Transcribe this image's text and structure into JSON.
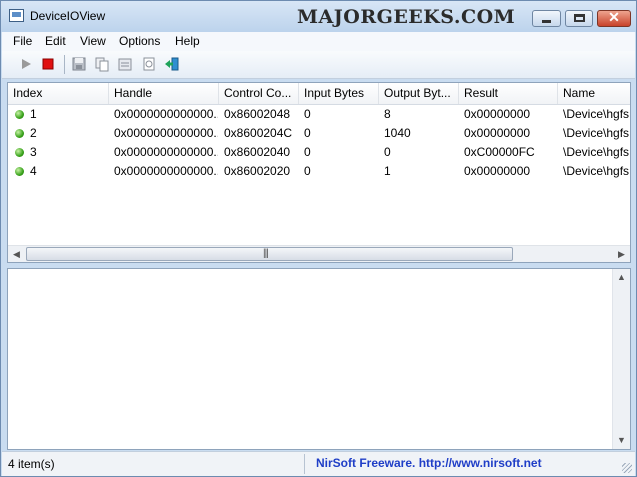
{
  "window": {
    "title": "DeviceIOView",
    "watermark": "MajorGeeks.com"
  },
  "menu": [
    {
      "label": "File"
    },
    {
      "label": "Edit"
    },
    {
      "label": "View"
    },
    {
      "label": "Options"
    },
    {
      "label": "Help"
    }
  ],
  "toolbar": {
    "icons": [
      "play-icon",
      "stop-icon",
      "save-icon",
      "copy-icon",
      "properties-icon",
      "html-report-icon",
      "exit-icon"
    ]
  },
  "table": {
    "columns": [
      "Index",
      "Handle",
      "Control Co...",
      "Input Bytes",
      "Output Byt...",
      "Result",
      "Name"
    ],
    "rows": [
      [
        "1",
        "0x0000000000000...",
        "0x86002048",
        "0",
        "8",
        "0x00000000",
        "\\Device\\hgfs"
      ],
      [
        "2",
        "0x0000000000000...",
        "0x8600204C",
        "0",
        "1040",
        "0x00000000",
        "\\Device\\hgfs"
      ],
      [
        "3",
        "0x0000000000000...",
        "0x86002040",
        "0",
        "0",
        "0xC00000FC",
        "\\Device\\hgfs"
      ],
      [
        "4",
        "0x0000000000000...",
        "0x86002020",
        "0",
        "1",
        "0x00000000",
        "\\Device\\hgfs"
      ]
    ]
  },
  "status": {
    "count": "4 item(s)",
    "link": "NirSoft Freeware.  http://www.nirsoft.net"
  },
  "colors": {
    "accent": "#1f3ec7",
    "row_dot": "#38a21a",
    "stop": "#e01010",
    "close": "#c8422a"
  }
}
